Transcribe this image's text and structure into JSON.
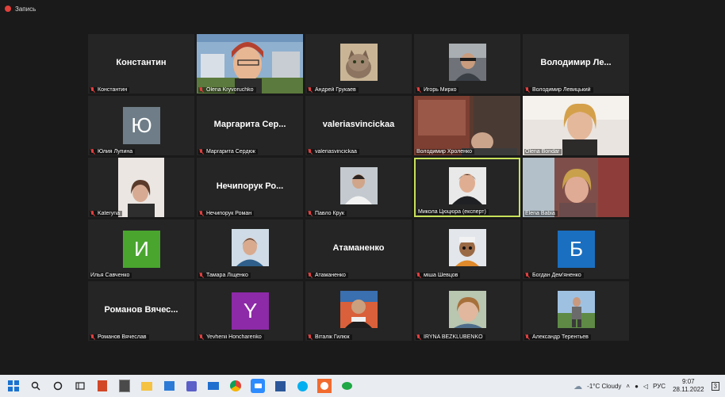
{
  "recording": {
    "label": "Запись"
  },
  "tiles": [
    {
      "name": "Константин",
      "big": "Константин"
    },
    {
      "name": "Olena Kryvoruchko"
    },
    {
      "name": "Андрей Грукаев"
    },
    {
      "name": "Игорь Мирко"
    },
    {
      "name": "Володимир Левицький",
      "big": "Володимир Ле..."
    },
    {
      "name": "Юлия Лупина",
      "letter": "Ю",
      "color": "#6e7d87"
    },
    {
      "name": "Маргарита Сердюк",
      "big": "Маргарита Сер..."
    },
    {
      "name": "valeriasvincickaa",
      "big": "valeriasvincickaa"
    },
    {
      "name": "Володимир Хроленко"
    },
    {
      "name": "Olena Bondar"
    },
    {
      "name": "Kateryna"
    },
    {
      "name": "Нечипорук Роман",
      "big": "Нечипорук Ро..."
    },
    {
      "name": "Павло Крук"
    },
    {
      "name": "Микола Цюцюра (експерт)",
      "active": true
    },
    {
      "name": "Elena Babia"
    },
    {
      "name": "Илья Савченко",
      "letter": "И",
      "color": "#4aa52f"
    },
    {
      "name": "Тамара Ліщенко"
    },
    {
      "name": "Атаманенко",
      "big": "Атаманенко"
    },
    {
      "name": "міша Шевцов"
    },
    {
      "name": "Богдан Дем'яненко",
      "letter": "Б",
      "color": "#1a6fc0"
    },
    {
      "name": "Романов Вячеслав",
      "big": "Романов Вячес..."
    },
    {
      "name": "Yevhenii Honcharenko",
      "letter": "Y",
      "color": "#8d2aa8"
    },
    {
      "name": "Віталік Гилюк"
    },
    {
      "name": "IRYNA BEZKLUBENKO"
    },
    {
      "name": "Александр Терентьев"
    }
  ],
  "taskbar": {
    "weather": "-1°C  Cloudy",
    "language": "РУС",
    "time": "9:07",
    "date": "28.11.2022",
    "notifications": "3"
  }
}
